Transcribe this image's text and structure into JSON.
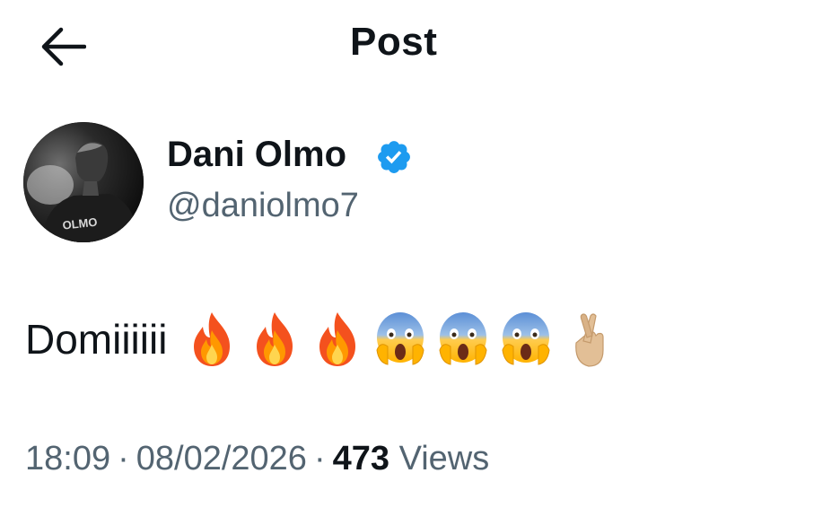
{
  "header": {
    "title": "Post",
    "back_icon": "arrow-left-icon"
  },
  "author": {
    "display_name": "Dani Olmo",
    "handle": "@daniolmo7",
    "verified": true,
    "verified_color": "#1d9bf0",
    "avatar_jersey_text": "OLMO"
  },
  "tweet": {
    "text": "Domiiiiii",
    "emojis": [
      "fire",
      "fire",
      "fire",
      "screaming-face",
      "screaming-face",
      "screaming-face",
      "crossed-fingers"
    ]
  },
  "meta": {
    "time": "18:09",
    "separator": "·",
    "date": "08/02/2026",
    "views_count": "473",
    "views_label": "Views"
  },
  "colors": {
    "text": "#0f1419",
    "secondary": "#536471",
    "background": "#ffffff"
  }
}
